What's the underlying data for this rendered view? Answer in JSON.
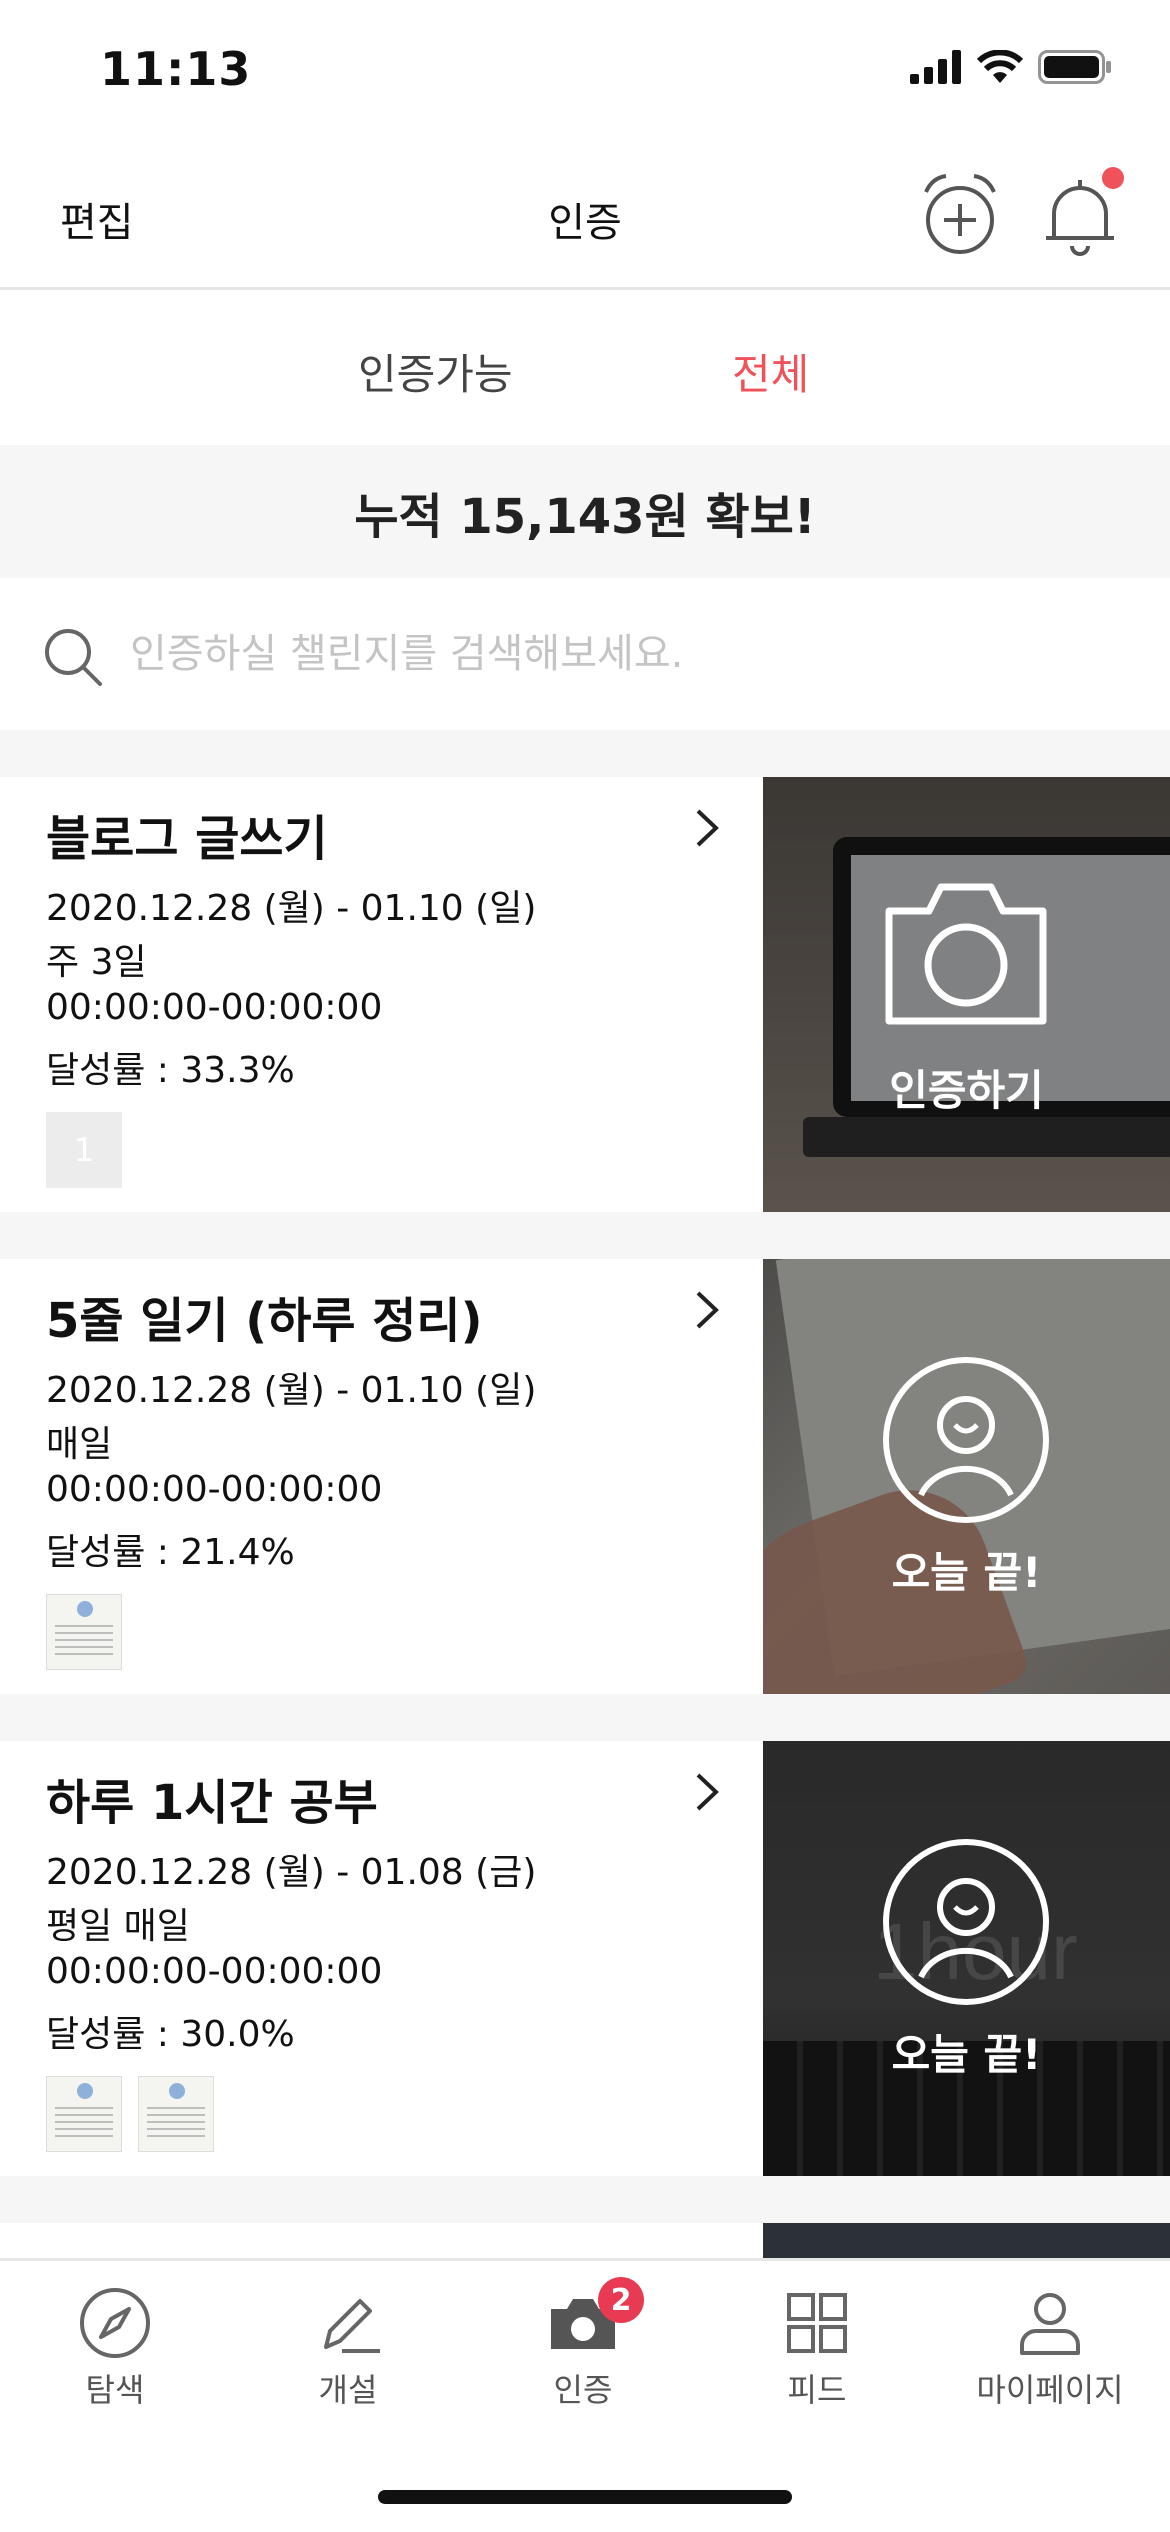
{
  "status_bar": {
    "time": "11:13"
  },
  "header": {
    "edit_label": "편집",
    "title": "인증"
  },
  "tabs": [
    {
      "label": "인증가능",
      "active": false
    },
    {
      "label": "전체",
      "active": true
    }
  ],
  "banner": "누적 15,143원 확보!",
  "search": {
    "placeholder": "인증하실 챌린지를 검색해보세요."
  },
  "colors": {
    "accent": "#f0525a",
    "badge": "#e83a53",
    "divider": "#f6f6f6"
  },
  "challenges": [
    {
      "name": "블로그 글쓰기",
      "period": "2020.12.28 (월) - 01.10 (일)",
      "frequency": "주 3일",
      "time": "00:00:00-00:00:00",
      "rate": "달성률 : 33.3%",
      "thumb_count_label": "1",
      "action_label": "인증하기",
      "action_icon": "camera-icon"
    },
    {
      "name": "5줄 일기 (하루 정리)",
      "period": "2020.12.28 (월) - 01.10 (일)",
      "frequency": "매일",
      "time": "00:00:00-00:00:00",
      "rate": "달성률 : 21.4%",
      "action_label": "오늘 끝!",
      "action_icon": "smile-face-icon"
    },
    {
      "name": "하루 1시간 공부",
      "period": "2020.12.28 (월) - 01.08 (금)",
      "frequency": "평일 매일",
      "time": "00:00:00-00:00:00",
      "rate": "달성률 : 30.0%",
      "photo_text": "1hour",
      "action_label": "오늘 끝!",
      "action_icon": "smile-face-icon"
    }
  ],
  "tabbar": {
    "items": [
      {
        "label": "탐색",
        "icon": "compass-icon"
      },
      {
        "label": "개설",
        "icon": "pencil-icon"
      },
      {
        "label": "인증",
        "icon": "camera-icon",
        "badge": "2",
        "active": true
      },
      {
        "label": "피드",
        "icon": "grid-icon"
      },
      {
        "label": "마이페이지",
        "icon": "person-icon"
      }
    ]
  }
}
